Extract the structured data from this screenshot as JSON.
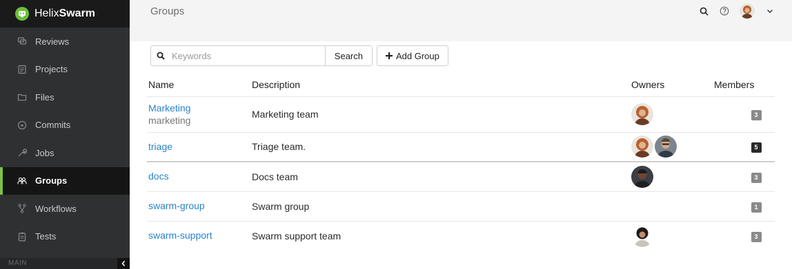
{
  "brand": {
    "name_light": "Helix",
    "name_bold": "Swarm"
  },
  "sidebar": {
    "items": [
      {
        "label": "Reviews",
        "icon": "reviews-icon"
      },
      {
        "label": "Projects",
        "icon": "projects-icon"
      },
      {
        "label": "Files",
        "icon": "folder-icon"
      },
      {
        "label": "Commits",
        "icon": "commits-icon"
      },
      {
        "label": "Jobs",
        "icon": "wrench-icon"
      },
      {
        "label": "Groups",
        "icon": "groups-icon",
        "active": true
      },
      {
        "label": "Workflows",
        "icon": "workflows-icon"
      },
      {
        "label": "Tests",
        "icon": "tests-icon"
      }
    ],
    "footer_label": "MAIN"
  },
  "header": {
    "title": "Groups"
  },
  "search": {
    "placeholder": "Keywords",
    "button_label": "Search"
  },
  "actions": {
    "add_group_label": "Add Group"
  },
  "table": {
    "columns": [
      "Name",
      "Description",
      "Owners",
      "Members"
    ],
    "rows": [
      {
        "name": "Marketing",
        "id": "marketing",
        "description": "Marketing team",
        "owners": [
          "avatar-red-hair"
        ],
        "members": "3"
      },
      {
        "name": "triage",
        "description": "Triage team.",
        "owners": [
          "avatar-red-hair",
          "avatar-glasses"
        ],
        "members": "5"
      },
      {
        "name": "docs",
        "description": "Docs team",
        "owners": [
          "avatar-dark"
        ],
        "members": "3"
      },
      {
        "name": "swarm-group",
        "description": "Swarm group",
        "owners": [],
        "members": "1"
      },
      {
        "name": "swarm-support",
        "description": "Swarm support team",
        "owners": [
          "avatar-curly"
        ],
        "members": "3"
      }
    ]
  },
  "colors": {
    "accent": "#7cc243",
    "link": "#2a83c6",
    "sidebar_bg": "#2f3031",
    "badge": "#8a8a8a"
  }
}
